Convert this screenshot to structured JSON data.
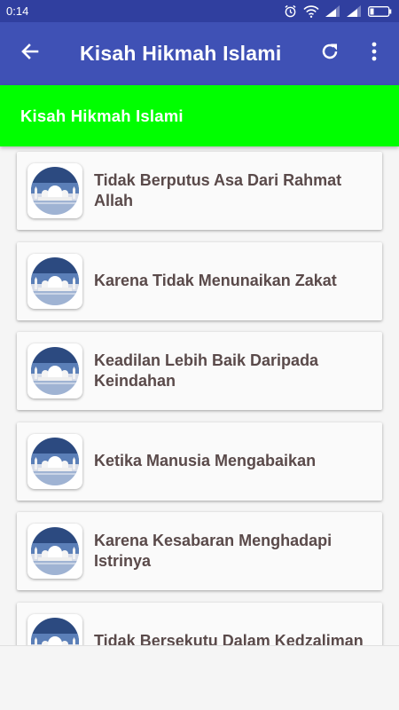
{
  "status_bar": {
    "time": "0:14"
  },
  "app_bar": {
    "title": "Kisah Hikmah Islami",
    "back_icon": "arrow-back-icon",
    "refresh_icon": "refresh-icon",
    "more_icon": "more-vert-icon"
  },
  "banner": {
    "text": "Kisah Hikmah Islami",
    "color": "#00ff00"
  },
  "colors": {
    "status_bar": "#303f9f",
    "app_bar": "#3f51b5",
    "card_text": "#5a4a4a"
  },
  "stories": [
    {
      "title": "Tidak Berputus Asa Dari Rahmat Allah",
      "icon": "mosque-thumbnail"
    },
    {
      "title": "Karena Tidak Menunaikan Zakat",
      "icon": "mosque-thumbnail"
    },
    {
      "title": "Keadilan Lebih Baik Daripada Keindahan",
      "icon": "mosque-thumbnail"
    },
    {
      "title": "Ketika Manusia Mengabaikan",
      "icon": "mosque-thumbnail"
    },
    {
      "title": "Karena Kesabaran Menghadapi Istrinya",
      "icon": "mosque-thumbnail"
    },
    {
      "title": "Tidak Bersekutu Dalam Kedzaliman",
      "icon": "mosque-thumbnail"
    }
  ]
}
